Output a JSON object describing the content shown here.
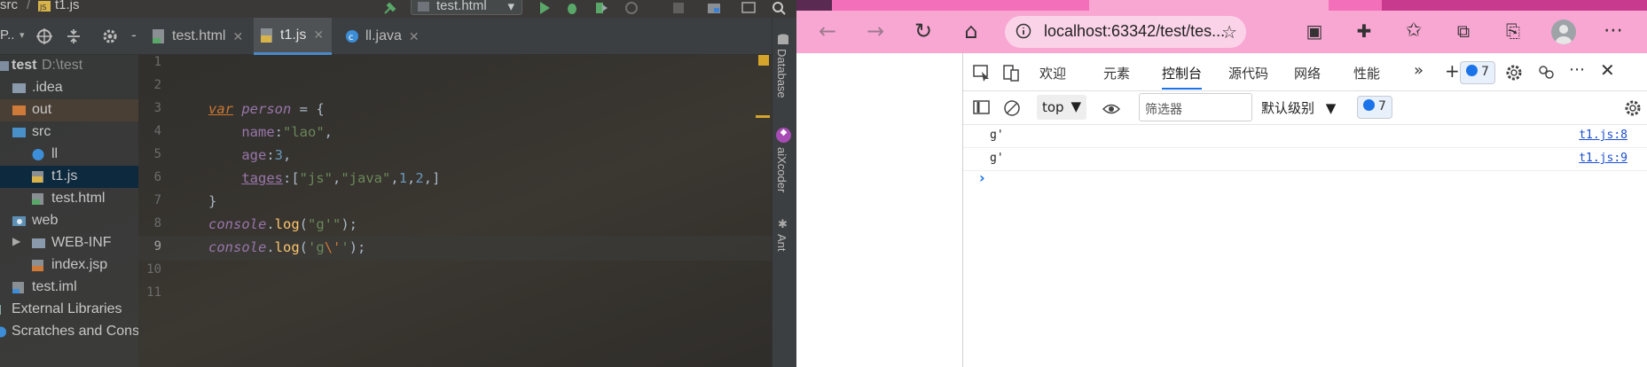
{
  "ide": {
    "breadcrumb": [
      "src",
      "t1.js"
    ],
    "run_config": "test.html",
    "project_label": "P..",
    "tabs": [
      {
        "label": "test.html",
        "icon": "html-file-icon"
      },
      {
        "label": "t1.js",
        "icon": "js-file-icon",
        "active": true
      },
      {
        "label": "ll.java",
        "icon": "java-class-icon"
      }
    ],
    "tree": [
      {
        "label": "test",
        "hint": "D:\\test",
        "icon": "module-folder-icon"
      },
      {
        "label": ".idea",
        "icon": "folder-icon"
      },
      {
        "label": "out",
        "icon": "excluded-folder-icon"
      },
      {
        "label": "src",
        "icon": "source-folder-icon"
      },
      {
        "label": "ll",
        "icon": "java-class-icon"
      },
      {
        "label": "t1.js",
        "icon": "js-file-icon",
        "selected": true
      },
      {
        "label": "test.html",
        "icon": "html-file-icon"
      },
      {
        "label": "web",
        "icon": "web-folder-icon"
      },
      {
        "label": "WEB-INF",
        "icon": "folder-icon"
      },
      {
        "label": "index.jsp",
        "icon": "jsp-file-icon"
      },
      {
        "label": "test.iml",
        "icon": "iml-file-icon"
      },
      {
        "label": "External Libraries",
        "icon": "library-icon"
      },
      {
        "label": "Scratches and Consoles",
        "icon": "scratches-icon"
      }
    ],
    "line_numbers": [
      "1",
      "2",
      "3",
      "4",
      "5",
      "6",
      "7",
      "8",
      "9",
      "10",
      "11"
    ],
    "current_line": 9,
    "code": {
      "l3_kw": "var",
      "l3_var": "person",
      "l3_rest": " = {",
      "l4_prop": "name",
      "l4_colon": ":",
      "l4_str": "\"lao\"",
      "l4_comma": ",",
      "l5_prop": "age",
      "l5_colon": ":",
      "l5_num": "3",
      "l5_comma": ",",
      "l6_prop": "tages",
      "l6_open": ":[",
      "l6_s1": "\"js\"",
      "l6_c1": ",",
      "l6_s2": "\"java\"",
      "l6_c2": ",",
      "l6_n1": "1",
      "l6_c3": ",",
      "l6_n2": "2",
      "l6_c4": ",",
      "l6_close": "]",
      "l7": "}",
      "l8_obj": "console",
      "l8_dot": ".",
      "l8_fn": "log",
      "l8_open": "(",
      "l8_str": "\"g'\"",
      "l8_close": ");",
      "l9_obj": "console",
      "l9_dot": ".",
      "l9_fn": "log",
      "l9_open": "(",
      "l9_s1": "'g",
      "l9_esc": "\\'",
      "l9_s2": "'",
      "l9_close": ");"
    },
    "side_tools": [
      "Database",
      "aiXcoder",
      "Ant"
    ]
  },
  "browser": {
    "url": "localhost:63342/test/tes...",
    "devtools_tabs": [
      "欢迎",
      "元素",
      "控制台",
      "源代码",
      "网络",
      "性能"
    ],
    "active_tab": "控制台",
    "issue_count": "7",
    "context": "top",
    "filter_placeholder": "筛选器",
    "level": "默认级别",
    "logs": [
      {
        "message": "g'",
        "source": "t1.js:8"
      },
      {
        "message": "g'",
        "source": "t1.js:9"
      }
    ],
    "prompt": "›"
  }
}
